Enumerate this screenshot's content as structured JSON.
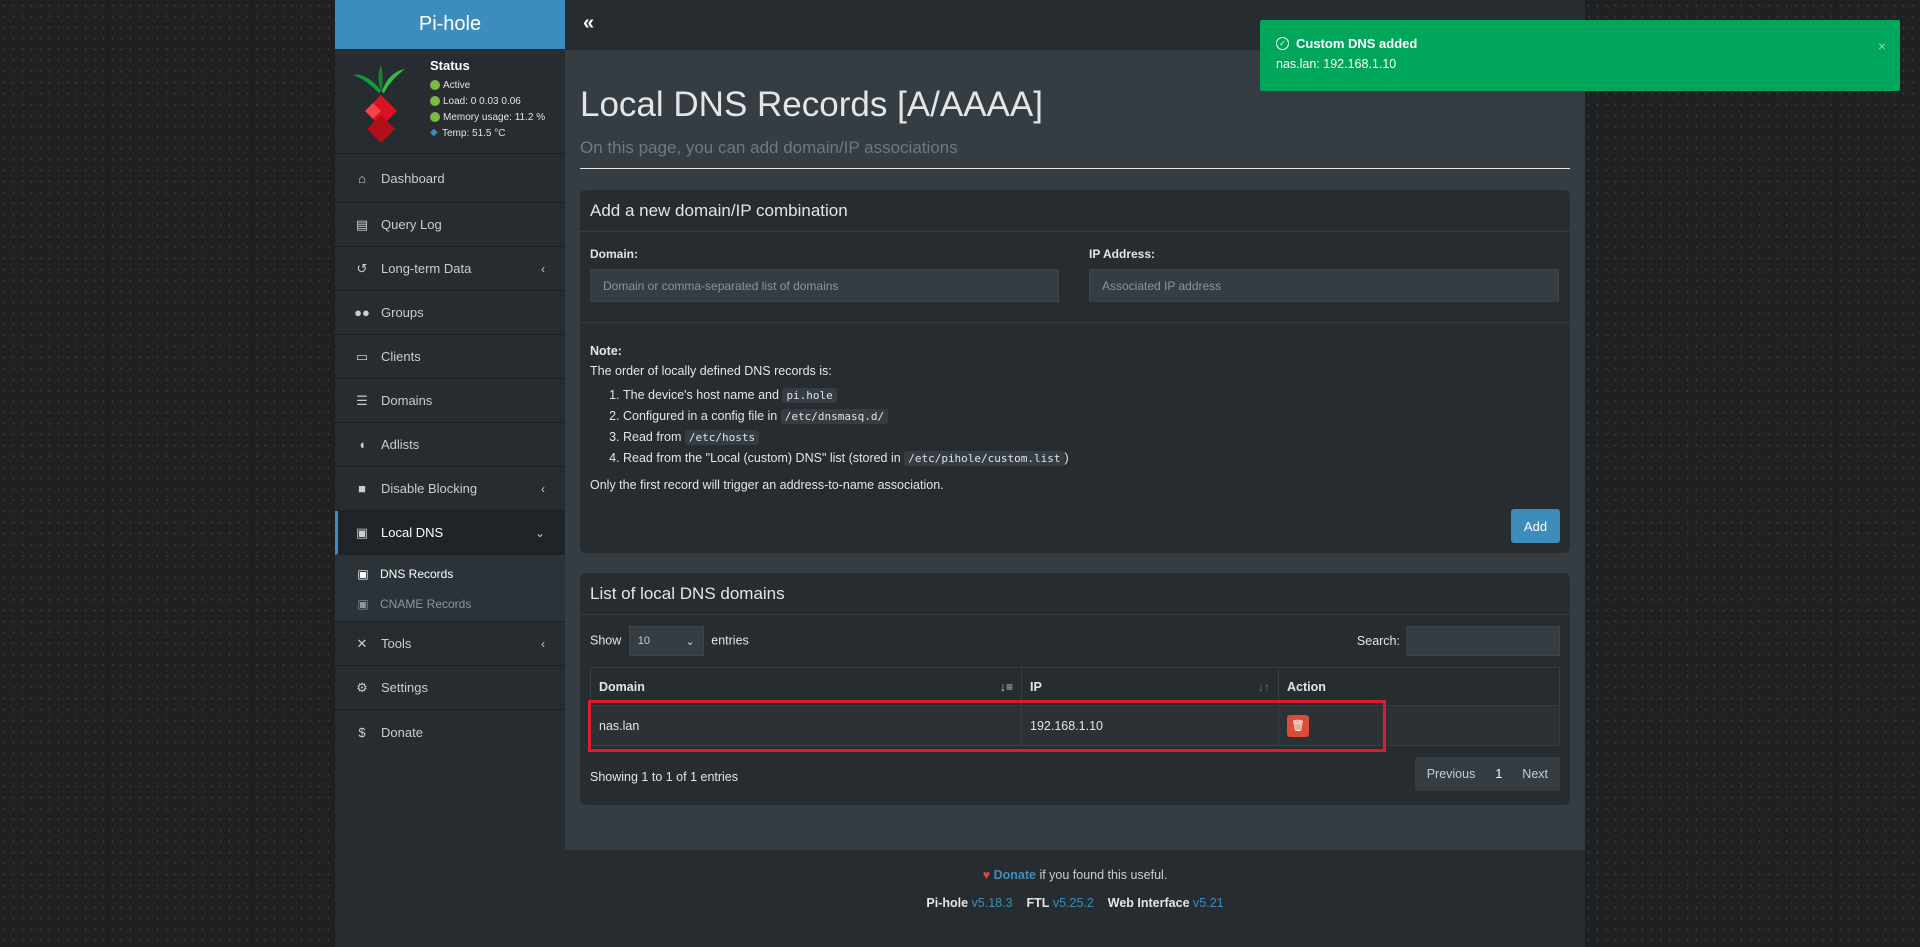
{
  "app": {
    "name": "Pi-hole"
  },
  "status": {
    "title": "Status",
    "active": "Active",
    "load": "Load:  0  0.03  0.06",
    "memory": "Memory usage:  11.2 %",
    "temp": "Temp: 51.5 °C"
  },
  "sidebar": {
    "items": [
      {
        "label": "Dashboard",
        "icon": "home-icon"
      },
      {
        "label": "Query Log",
        "icon": "file-icon"
      },
      {
        "label": "Long-term Data",
        "icon": "history-icon"
      },
      {
        "label": "Groups",
        "icon": "users-icon"
      },
      {
        "label": "Clients",
        "icon": "laptop-icon"
      },
      {
        "label": "Domains",
        "icon": "list-icon"
      },
      {
        "label": "Adlists",
        "icon": "shield-icon"
      },
      {
        "label": "Disable Blocking",
        "icon": "stop-icon"
      },
      {
        "label": "Local DNS",
        "icon": "address-book-icon"
      },
      {
        "label": "Tools",
        "icon": "tools-icon"
      },
      {
        "label": "Settings",
        "icon": "gear-icon"
      },
      {
        "label": "Donate",
        "icon": "donate-icon"
      }
    ],
    "submenu": [
      {
        "label": "DNS Records"
      },
      {
        "label": "CNAME Records"
      }
    ]
  },
  "page": {
    "title": "Local DNS Records [A/AAAA]",
    "subtitle": "On this page, you can add domain/IP associations"
  },
  "add_box": {
    "title": "Add a new domain/IP combination",
    "domain_label": "Domain:",
    "domain_placeholder": "Domain or comma-separated list of domains",
    "ip_label": "IP Address:",
    "ip_placeholder": "Associated IP address",
    "note_title": "Note:",
    "note_intro": "The order of locally defined DNS records is:",
    "note_items": [
      {
        "text": "The device's host name and ",
        "code": "pi.hole",
        "tail": ""
      },
      {
        "text": "Configured in a config file in ",
        "code": "/etc/dnsmasq.d/",
        "tail": ""
      },
      {
        "text": "Read from ",
        "code": "/etc/hosts",
        "tail": ""
      },
      {
        "text": "Read from the \"Local (custom) DNS\" list (stored in ",
        "code": "/etc/pihole/custom.list",
        "tail": ")"
      }
    ],
    "note_footer": "Only the first record will trigger an address-to-name association.",
    "add_button": "Add"
  },
  "list_box": {
    "title": "List of local DNS domains",
    "show_label": "Show",
    "entries_value": "10",
    "entries_label": "entries",
    "search_label": "Search:",
    "columns": [
      "Domain",
      "IP",
      "Action"
    ],
    "rows": [
      {
        "domain": "nas.lan",
        "ip": "192.168.1.10"
      }
    ],
    "info": "Showing 1 to 1 of 1 entries",
    "pager": {
      "prev": "Previous",
      "page": "1",
      "next": "Next"
    }
  },
  "footer": {
    "donate_link": "Donate",
    "donate_text": " if you found this useful.",
    "pihole_label": "Pi-hole",
    "pihole_version": "v5.18.3",
    "ftl_label": "FTL",
    "ftl_version": "v5.25.2",
    "web_label": "Web Interface",
    "web_version": "v5.21"
  },
  "toast": {
    "title": "Custom DNS added",
    "message": "nas.lan: 192.168.1.10",
    "close": "×"
  },
  "colors": {
    "accent": "#3c8dbc",
    "success": "#00a65a",
    "danger": "#dd4b39",
    "highlight": "#e0192b"
  }
}
